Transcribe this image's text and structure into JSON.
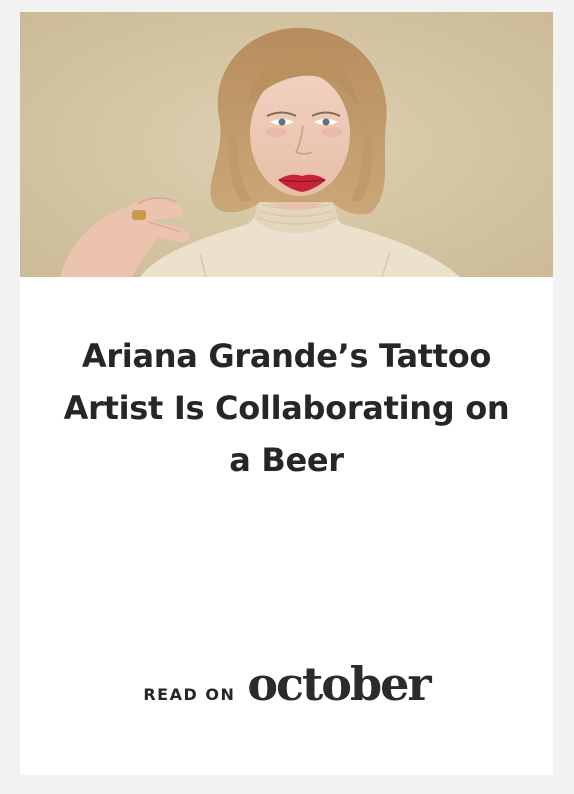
{
  "card": {
    "image_alt": "Woman in a cream turtleneck sweater",
    "headline": "Ariana Grande’s Tattoo Artist Is Collaborating on a Beer",
    "cta_prefix": "READ ON",
    "cta_brand": "october"
  },
  "colors": {
    "page_bg": "#f2f2f2",
    "card_bg": "#ffffff",
    "text": "#262626",
    "photo_bg": "#d5c5a4"
  }
}
